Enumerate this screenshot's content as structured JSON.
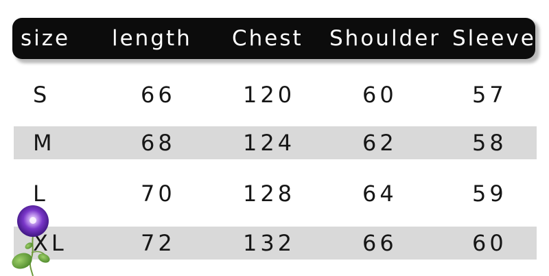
{
  "table": {
    "headers": [
      "size",
      "length",
      "Chest",
      "Shoulder",
      "Sleeve"
    ],
    "rows": [
      [
        "S",
        "66",
        "120",
        "60",
        "57"
      ],
      [
        "M",
        "68",
        "124",
        "62",
        "58"
      ],
      [
        "L",
        "70",
        "128",
        "64",
        "59"
      ],
      [
        "XL",
        "72",
        "132",
        "66",
        "60"
      ]
    ]
  },
  "colors": {
    "header_background": "#0c0c0c",
    "header_text": "#ffffff",
    "row_shade": "#d9d9d9",
    "body_text": "#161616"
  },
  "decoration": {
    "icon": "purple-flower-icon"
  }
}
